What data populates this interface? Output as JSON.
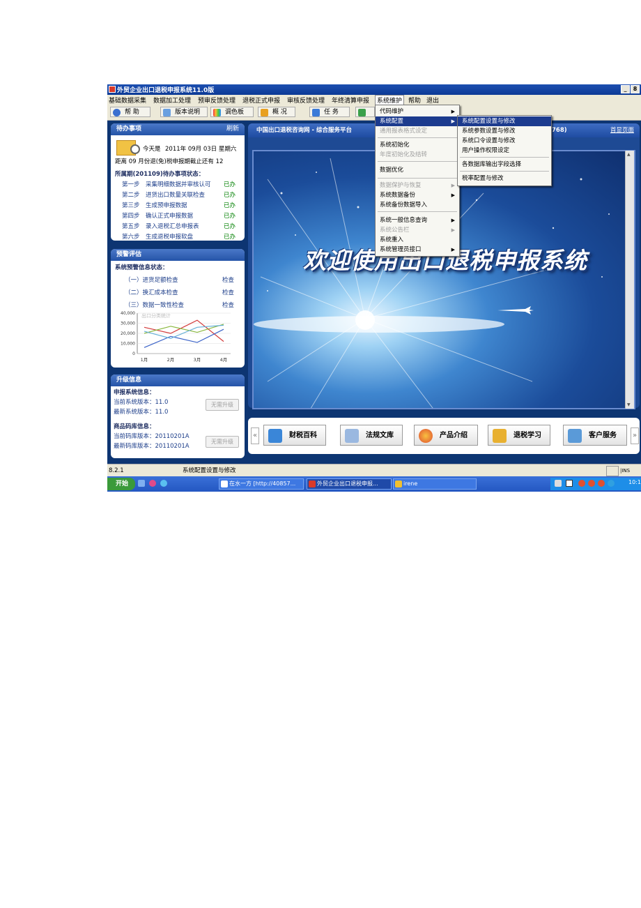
{
  "window": {
    "title": "外贸企业出口退税申报系统11.0版",
    "min_btn": "_",
    "max_btn": "8"
  },
  "menubar": [
    "基础数据采集",
    "数据加工处理",
    "预审反馈处理",
    "退税正式申报",
    "审核反馈处理",
    "年终清算申报",
    "系统维护",
    "帮助",
    "退出"
  ],
  "toolbar": {
    "help": "帮 助",
    "version": "版本说明",
    "palette": "调色板",
    "overview": "概 况",
    "task": "任 务"
  },
  "todo": {
    "header": "待办事项",
    "refresh": "刷新",
    "today_prefix": "今天是",
    "today_value": "2011年 09月 03日 星期六",
    "deadline_text": "距离 09 月份退(免)税申报期截止还有 12",
    "period_title": "所属期(201109)待办事项状态：",
    "steps": [
      {
        "step": "第一步",
        "text": "采集明细数据并审核认可",
        "status": "已办"
      },
      {
        "step": "第二步",
        "text": "进货出口数量关联检查",
        "status": "已办"
      },
      {
        "step": "第三步",
        "text": "生成预申报数据",
        "status": "已办"
      },
      {
        "step": "第四步",
        "text": "确认正式申报数据",
        "status": "已办"
      },
      {
        "step": "第五步",
        "text": "录入退税汇总申报表",
        "status": "已办"
      },
      {
        "step": "第六步",
        "text": "生成退税申报软盘",
        "status": "已办"
      }
    ]
  },
  "warning": {
    "header": "预警评估",
    "title": "系统预警信息状态：",
    "items": [
      {
        "label": "（一）进货足额检查",
        "action": "检查"
      },
      {
        "label": "（二）换汇成本检查",
        "action": "检查"
      },
      {
        "label": "（三）数据一致性检查",
        "action": "检查"
      }
    ]
  },
  "chart_data": {
    "type": "line",
    "title": "出口分类统计",
    "categories": [
      "1月",
      "2月",
      "3月",
      "4月"
    ],
    "y_ticks": [
      "40,000",
      "30,000",
      "20,000",
      "10,000",
      "0"
    ],
    "ylim": [
      0,
      40000
    ],
    "series": [
      {
        "values": [
          26000,
          20000,
          33000,
          12000
        ],
        "color": "#d33a3a"
      },
      {
        "values": [
          20000,
          27000,
          21000,
          29000
        ],
        "color": "#8ab83e"
      },
      {
        "values": [
          6000,
          17000,
          11000,
          24000
        ],
        "color": "#3a62c8"
      },
      {
        "values": [
          22000,
          15000,
          26000,
          28000
        ],
        "color": "#66b0d8"
      }
    ]
  },
  "upgrade": {
    "header": "升级信息",
    "sys_title": "申报系统信息：",
    "cur_sys": "当前系统版本：11.0",
    "new_sys": "最新系统版本：11.0",
    "btn": "无需升级",
    "db_title": "商品码库信息：",
    "cur_db": "当前码库版本：20110201A",
    "new_db": "最新码库版本：20110201A"
  },
  "main": {
    "header": "中国出口退税咨询网 - 综合服务平台",
    "header_suffix": "768)",
    "home_link": "首显页面",
    "welcome": "欢迎使用出口退税申报系统"
  },
  "bottom_buttons": [
    "财税百科",
    "法规文库",
    "产品介绍",
    "退税学习",
    "客户服务"
  ],
  "nav": {
    "prev": "«",
    "next": "»"
  },
  "dropdown": {
    "items": [
      {
        "label": "代码维护",
        "arrow": "▶"
      },
      {
        "label": "系统配置",
        "arrow": "▶"
      },
      {
        "label": "通用报表格式设定"
      },
      {
        "label": "系统初始化"
      },
      {
        "label": "年度初始化及结转"
      },
      {
        "label": "数据优化"
      },
      {
        "label": "数据保护与恢复",
        "arrow": "▶"
      },
      {
        "label": "系统数据备份",
        "arrow": "▶"
      },
      {
        "label": "系统备份数据导入"
      },
      {
        "label": "系统一般信息查询",
        "arrow": "▶"
      },
      {
        "label": "系统公告栏",
        "arrow": "▶"
      },
      {
        "label": "系统重入"
      },
      {
        "label": "系统管理员接口",
        "arrow": "▶"
      }
    ]
  },
  "submenu": {
    "items": [
      "系统配置设置与修改",
      "系统参数设置与修改",
      "系统口令设置与修改",
      "用户操作权限设定",
      "各数据库输出字段选择",
      "税率配置与修改"
    ]
  },
  "statusbar": {
    "version": "8.2.1",
    "text": "系统配置设置与修改",
    "ime": "|INS"
  },
  "taskbar": {
    "start": "开始",
    "tasks": [
      "在水一方 [http://40857...",
      "外贸企业出口退税申报...",
      "irene"
    ],
    "clock": "10:1"
  }
}
